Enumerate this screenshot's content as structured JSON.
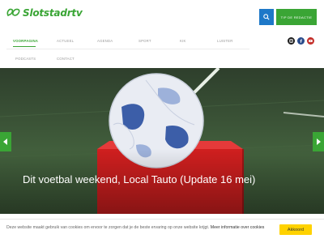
{
  "header": {
    "logo_text": "Slotstadrtv",
    "broadcast_label": "TIP DE REDACTIE",
    "search_icon": "search-icon"
  },
  "nav": {
    "items": [
      {
        "label": "VOORPAGINA",
        "active": true
      },
      {
        "label": "ACTUEEL",
        "active": false
      },
      {
        "label": "AGENDA",
        "active": false
      },
      {
        "label": "SPORT",
        "active": false
      },
      {
        "label": "KIK",
        "active": false
      },
      {
        "label": "LUISTER",
        "active": false
      },
      {
        "label": "PODCASTS",
        "active": false
      },
      {
        "label": "CONTACT",
        "active": false
      }
    ],
    "social": [
      {
        "icon": "instagram-icon",
        "color": "#1a1a1a"
      },
      {
        "icon": "facebook-icon",
        "color": "#2b4c8c"
      },
      {
        "icon": "youtube-icon",
        "color": "#c4302b"
      }
    ]
  },
  "hero": {
    "headline": "Dit voetbal weekend, Local Tauto (Update 16 mei)",
    "prev_icon": "chevron-left-icon",
    "next_icon": "chevron-right-icon"
  },
  "cookie": {
    "text": "Deze website maakt gebruik van cookies om ervoor te zorgen dat je de beste ervaring op onze website krijgt.",
    "link": "Meer informatie over cookies",
    "accept_label": "Akkoord"
  },
  "colors": {
    "brand_green": "#3aa535",
    "search_blue": "#1e78c8",
    "accept_yellow": "#ffd200"
  }
}
